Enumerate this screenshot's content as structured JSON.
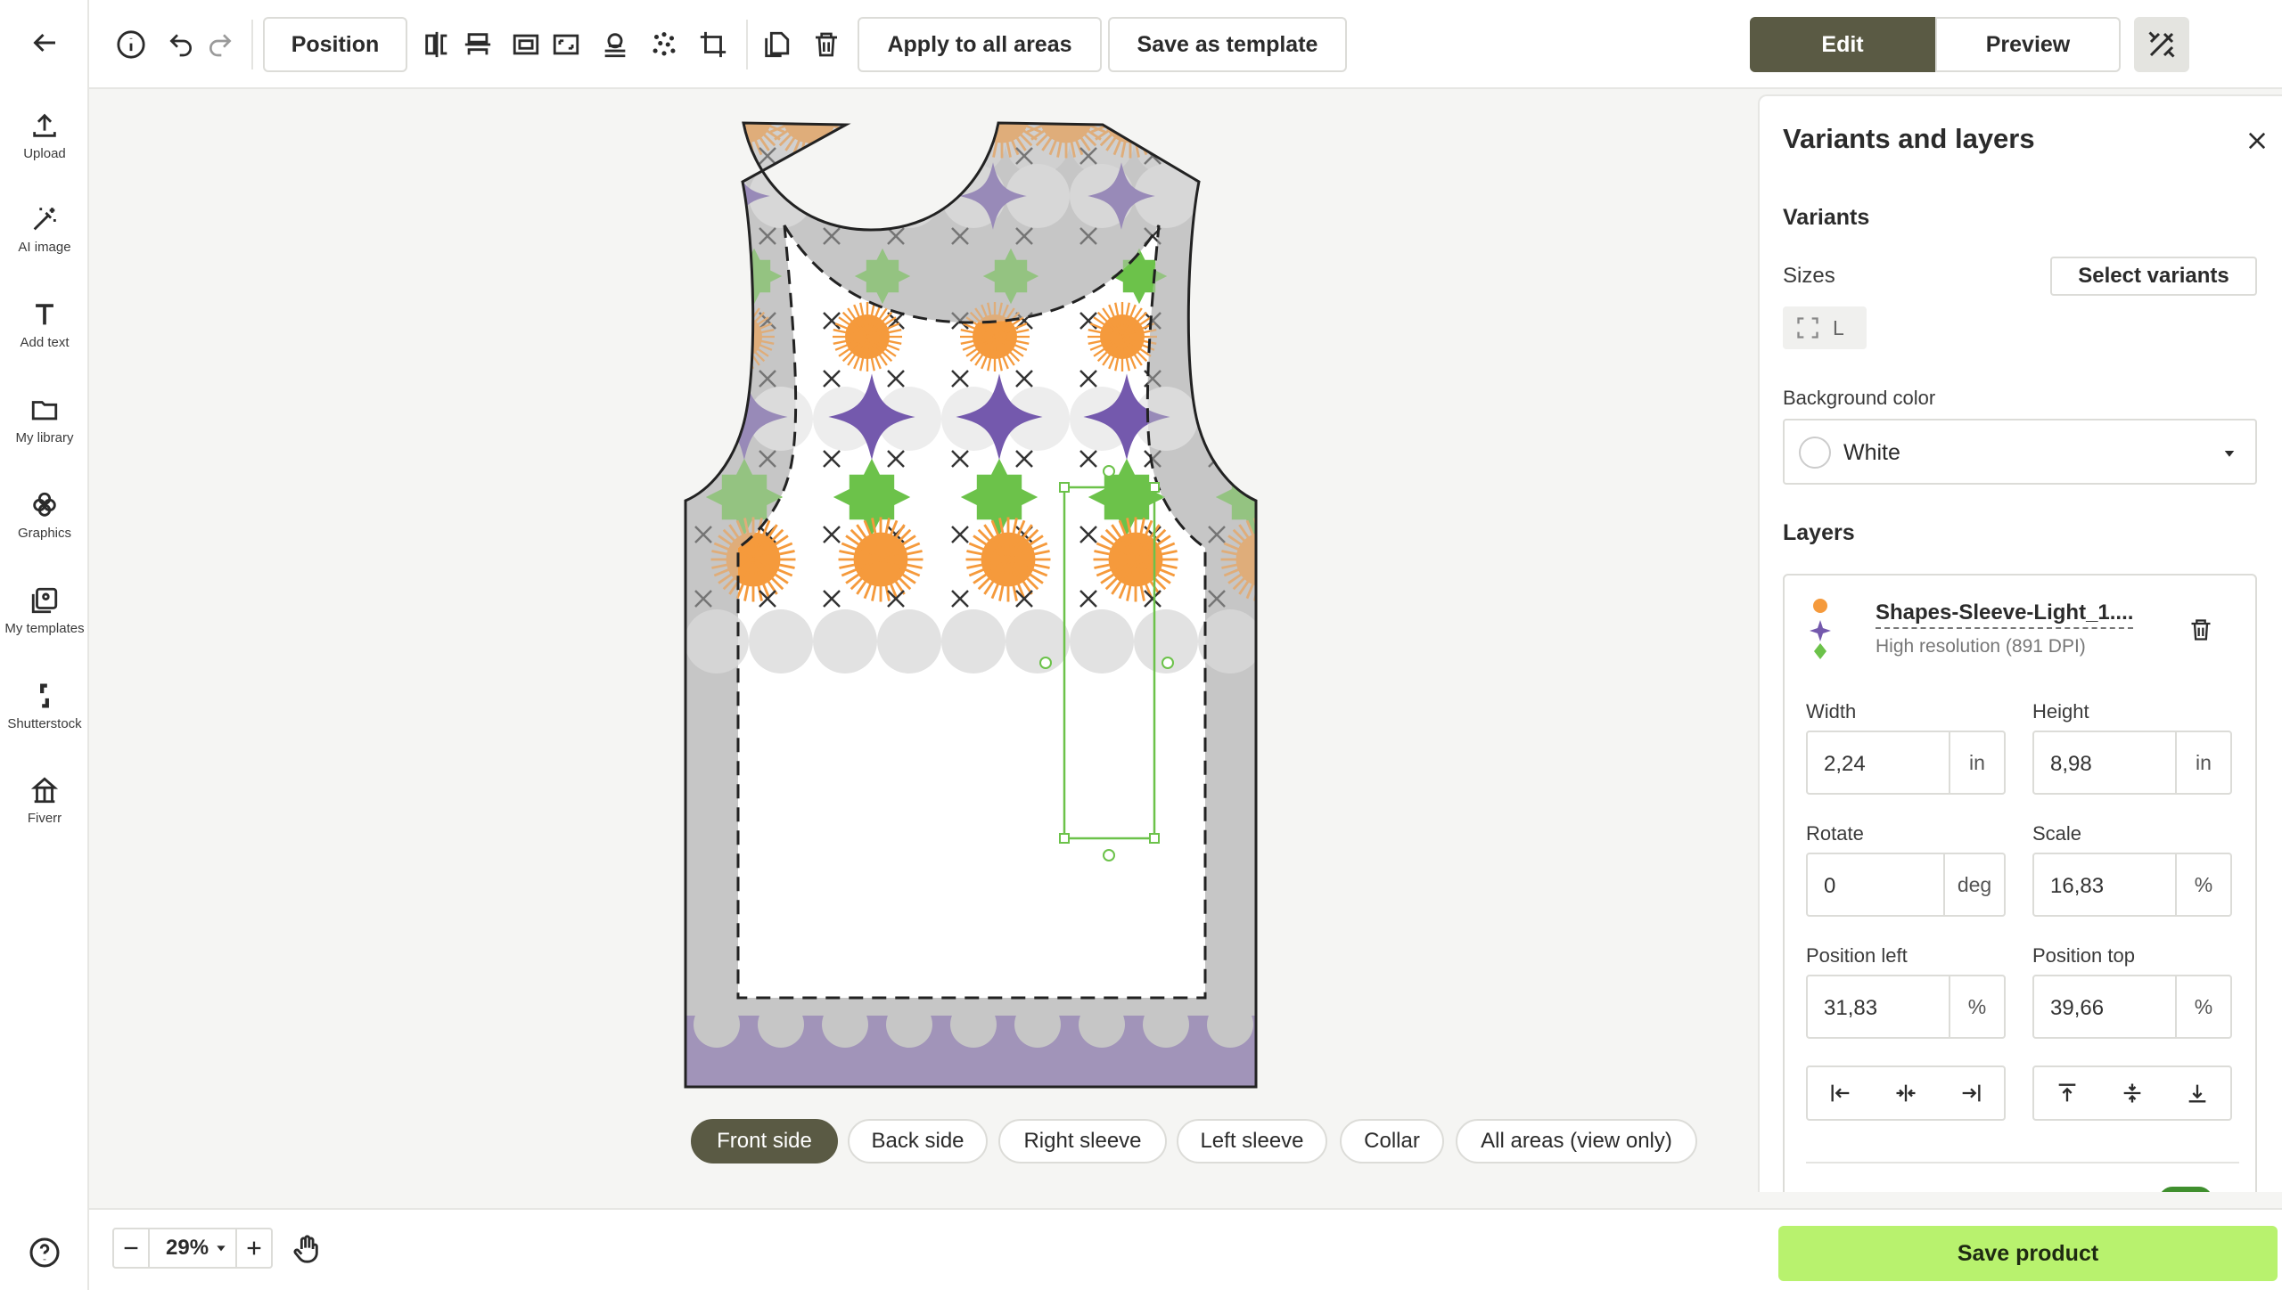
{
  "rail": {
    "items": [
      {
        "label": "Upload",
        "icon": "upload-icon"
      },
      {
        "label": "AI image",
        "icon": "magic-wand-icon"
      },
      {
        "label": "Add text",
        "icon": "text-icon"
      },
      {
        "label": "My library",
        "icon": "folder-icon"
      },
      {
        "label": "Graphics",
        "icon": "flower-icon"
      },
      {
        "label": "My templates",
        "icon": "templates-icon"
      },
      {
        "label": "Shutterstock",
        "icon": "shutterstock-icon"
      },
      {
        "label": "Fiverr",
        "icon": "fiverr-icon"
      }
    ]
  },
  "toolbar": {
    "position_label": "Position",
    "apply_all_label": "Apply to all areas",
    "save_template_label": "Save as template",
    "edit_label": "Edit",
    "preview_label": "Preview"
  },
  "tabs": [
    {
      "label": "Front side",
      "active": true
    },
    {
      "label": "Back side",
      "active": false
    },
    {
      "label": "Right sleeve",
      "active": false
    },
    {
      "label": "Left sleeve",
      "active": false
    },
    {
      "label": "Collar",
      "active": false
    },
    {
      "label": "All areas (view only)",
      "active": false
    }
  ],
  "zoom": {
    "value": "29%"
  },
  "save_product_label": "Save product",
  "panel": {
    "title": "Variants and layers",
    "variants_heading": "Variants",
    "sizes_label": "Sizes",
    "select_variants_label": "Select variants",
    "size_chip": "L",
    "bg_color_label": "Background color",
    "bg_color_value": "White",
    "layers_heading": "Layers",
    "layer": {
      "name": "Shapes-Sleeve-Light_1....",
      "resolution": "High resolution (891 DPI)"
    },
    "fields": {
      "width_label": "Width",
      "width_value": "2,24",
      "width_unit": "in",
      "height_label": "Height",
      "height_value": "8,98",
      "height_unit": "in",
      "rotate_label": "Rotate",
      "rotate_value": "0",
      "rotate_unit": "deg",
      "scale_label": "Scale",
      "scale_value": "16,83",
      "scale_unit": "%",
      "left_label": "Position left",
      "left_value": "31,83",
      "left_unit": "%",
      "top_label": "Position top",
      "top_value": "39,66",
      "top_unit": "%"
    }
  },
  "colors": {
    "accent_dark": "#5a5a44",
    "save_green": "#b8f26e",
    "pattern_orange": "#f59a3c",
    "pattern_purple": "#7459ad",
    "pattern_green": "#6cc24a"
  }
}
